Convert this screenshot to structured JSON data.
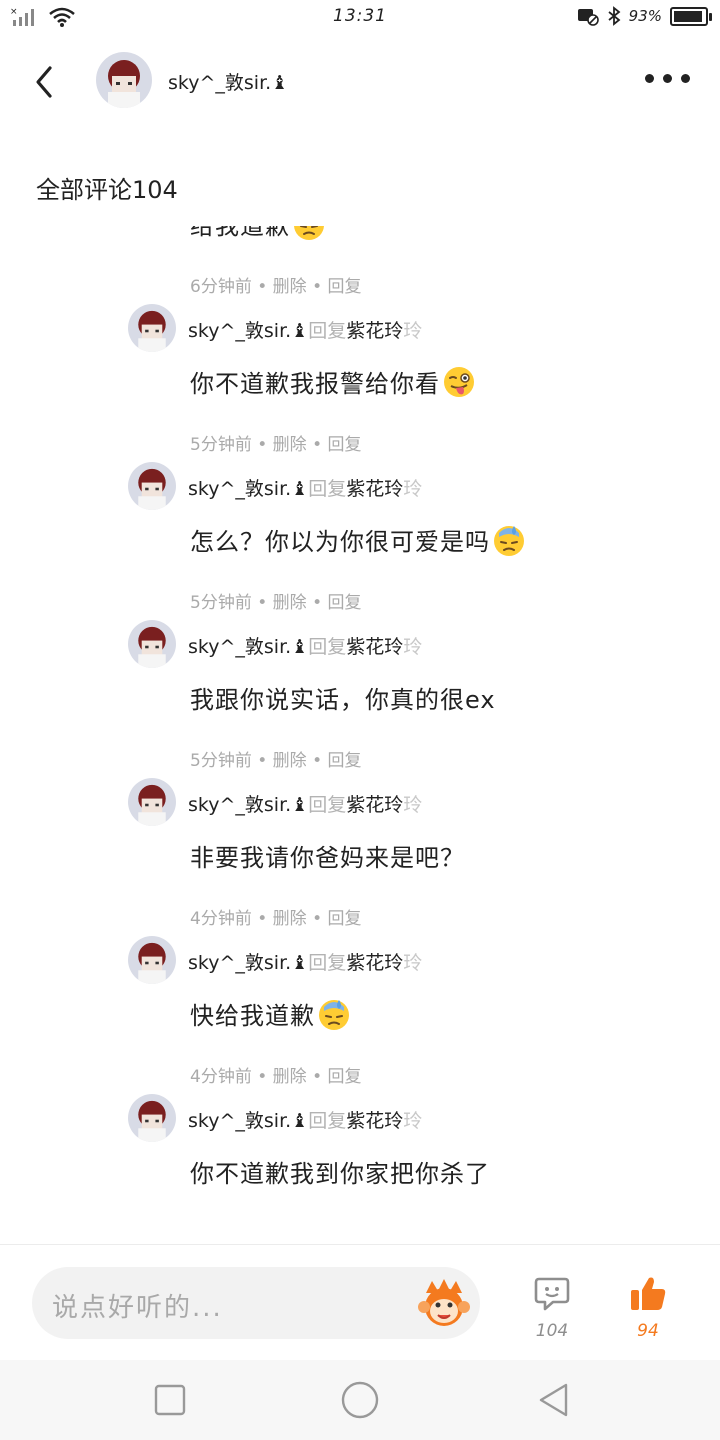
{
  "status_bar": {
    "time": "13:31",
    "battery_text": "93%",
    "battery_level": 0.93
  },
  "header": {
    "username": "sky^_敦sir.♝"
  },
  "section": {
    "title": "全部评论104"
  },
  "comments": [
    {
      "author": "",
      "reply_word": "",
      "target": "",
      "target_tail": "",
      "text": "给我道歉",
      "emoji": "sweat-emoji",
      "time": "6分钟前",
      "delete_label": "删除",
      "reply_label": "回复",
      "dot": "•"
    },
    {
      "author": "sky^_敦sir.♝",
      "reply_word": "回复",
      "target": "紫花玲",
      "target_tail": "玲",
      "text": "你不道歉我报警给你看",
      "emoji": "wink-tongue-emoji",
      "time": "5分钟前",
      "delete_label": "删除",
      "reply_label": "回复",
      "dot": "•"
    },
    {
      "author": "sky^_敦sir.♝",
      "reply_word": "回复",
      "target": "紫花玲",
      "target_tail": "玲",
      "text": "怎么？你以为你很可爱是吗",
      "emoji": "sweat-emoji",
      "time": "5分钟前",
      "delete_label": "删除",
      "reply_label": "回复",
      "dot": "•"
    },
    {
      "author": "sky^_敦sir.♝",
      "reply_word": "回复",
      "target": "紫花玲",
      "target_tail": "玲",
      "text": "我跟你说实话，你真的很ex",
      "emoji": "",
      "time": "5分钟前",
      "delete_label": "删除",
      "reply_label": "回复",
      "dot": "•"
    },
    {
      "author": "sky^_敦sir.♝",
      "reply_word": "回复",
      "target": "紫花玲",
      "target_tail": "玲",
      "text": "非要我请你爸妈来是吧？",
      "emoji": "",
      "time": "4分钟前",
      "delete_label": "删除",
      "reply_label": "回复",
      "dot": "•"
    },
    {
      "author": "sky^_敦sir.♝",
      "reply_word": "回复",
      "target": "紫花玲",
      "target_tail": "玲",
      "text": "快给我道歉",
      "emoji": "sweat-emoji",
      "time": "4分钟前",
      "delete_label": "删除",
      "reply_label": "回复",
      "dot": "•"
    },
    {
      "author": "sky^_敦sir.♝",
      "reply_word": "回复",
      "target": "紫花玲",
      "target_tail": "玲",
      "text": "你不道歉我到你家把你杀了",
      "emoji": "",
      "time": "",
      "delete_label": "",
      "reply_label": "",
      "dot": ""
    }
  ],
  "bottom_bar": {
    "input_placeholder": "说点好听的...",
    "comment_count": "104",
    "like_count": "94",
    "accent_color": "#f47a1f"
  },
  "icons": {
    "back": "back-arrow-icon",
    "more": "more-icon",
    "comment": "comment-icon",
    "like": "thumbs-up-icon",
    "sticker": "monkey-emoji-icon"
  }
}
